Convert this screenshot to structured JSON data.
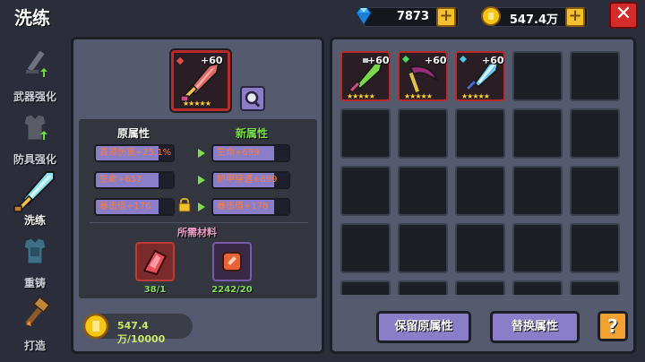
{
  "header": {
    "title": "洗练",
    "diamonds": "7873",
    "gold": "547.4万",
    "plus_label": "+",
    "close_label": "✕"
  },
  "sidebar": {
    "items": [
      {
        "label": "武器强化",
        "icon": "sword-upgrade-icon"
      },
      {
        "label": "防具强化",
        "icon": "armor-upgrade-icon"
      },
      {
        "label": "洗练",
        "icon": "refine-sword-icon",
        "active": true
      },
      {
        "label": "重铸",
        "icon": "reforge-armor-icon"
      },
      {
        "label": "打造",
        "icon": "forge-hammer-icon"
      }
    ]
  },
  "refine": {
    "item_level": "+60",
    "item_stars": "★★★★★",
    "old_header": "原属性",
    "new_header": "新属性",
    "old_attrs": [
      "首领伤害+25.1%",
      "生命+657",
      "暴击值+176"
    ],
    "new_attrs": [
      "生命+699",
      "护甲穿透+899",
      "暴击值+176"
    ],
    "materials_header": "所需材料",
    "materials": [
      {
        "count": "38/1",
        "icon": "red-crystal-icon"
      },
      {
        "count": "2242/20",
        "icon": "orange-token-icon"
      }
    ],
    "gold_cost": "547.4万/10000"
  },
  "inventory": {
    "items": [
      {
        "level": "+60",
        "stars": "★★★★★",
        "icon": "green-sword-icon"
      },
      {
        "level": "+60",
        "stars": "★★★★★",
        "icon": "purple-scythe-icon"
      },
      {
        "level": "+60",
        "stars": "★★★★★",
        "icon": "ice-spear-icon"
      }
    ]
  },
  "actions": {
    "keep_label": "保留原属性",
    "replace_label": "替换属性",
    "help_label": "?"
  },
  "colors": {
    "accent": "#8a7ec8",
    "rarity_border": "#b92a2a",
    "new_attr_header": "#7be04a",
    "close_red": "#d42a2a"
  }
}
